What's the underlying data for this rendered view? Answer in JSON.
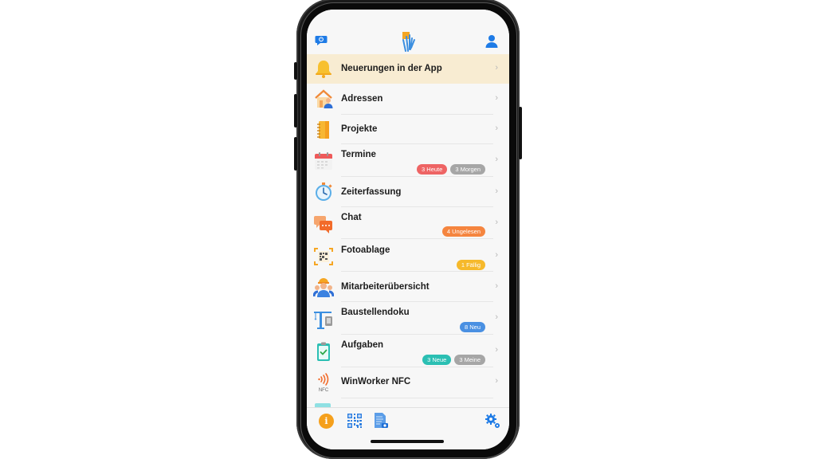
{
  "header": {
    "left_icon": "chat-bubble-icon",
    "logo": "app-logo",
    "right_icon": "user-icon"
  },
  "menu": [
    {
      "label": "Neuerungen in der App",
      "icon": "bell-icon",
      "highlighted": true,
      "badges": []
    },
    {
      "label": "Adressen",
      "icon": "house-person-icon",
      "badges": []
    },
    {
      "label": "Projekte",
      "icon": "notebook-icon",
      "badges": []
    },
    {
      "label": "Termine",
      "icon": "calendar-icon",
      "badges": [
        {
          "text": "3 Heute",
          "color": "#ee6464"
        },
        {
          "text": "3 Morgen",
          "color": "#a6a6a6"
        }
      ]
    },
    {
      "label": "Zeiterfassung",
      "icon": "stopwatch-icon",
      "badges": []
    },
    {
      "label": "Chat",
      "icon": "chat-icon",
      "badges": [
        {
          "text": "4 Ungelesen",
          "color": "#f5853f"
        }
      ]
    },
    {
      "label": "Fotoablage",
      "icon": "qr-scan-icon",
      "badges": [
        {
          "text": "1 Fällig",
          "color": "#f6b92b"
        }
      ]
    },
    {
      "label": "Mitarbeiterübersicht",
      "icon": "workers-icon",
      "badges": []
    },
    {
      "label": "Baustellendoku",
      "icon": "crane-icon",
      "badges": [
        {
          "text": "8 Neu",
          "color": "#4a90e2"
        }
      ]
    },
    {
      "label": "Aufgaben",
      "icon": "clipboard-check-icon",
      "badges": [
        {
          "text": "3 Neue",
          "color": "#2bbfb3"
        },
        {
          "text": "3 Meine",
          "color": "#a6a6a6"
        }
      ]
    },
    {
      "label": "WinWorker NFC",
      "icon": "nfc-icon",
      "nfc_text": "NFC",
      "badges": []
    }
  ],
  "chevron": "›",
  "tabbar": {
    "info_icon": "info-icon",
    "qr_icon": "qr-code-icon",
    "doc_icon": "document-camera-icon",
    "settings_icon": "settings-gears-icon",
    "info_glyph": "i"
  }
}
